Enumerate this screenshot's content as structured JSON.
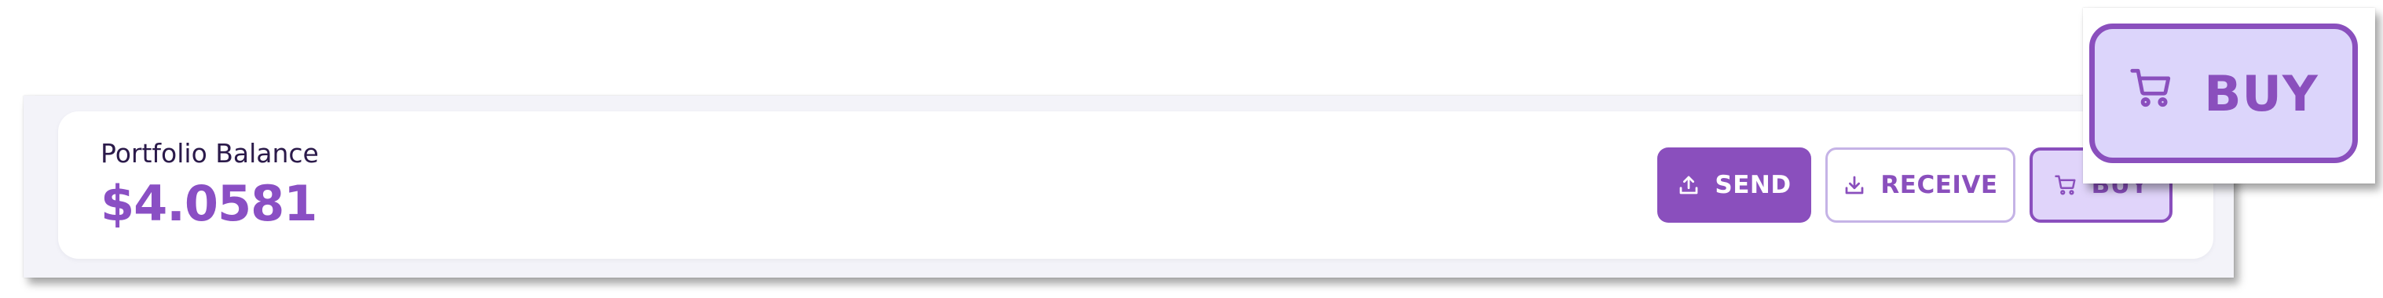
{
  "portfolio": {
    "label": "Portfolio Balance",
    "balance": "$4.0581"
  },
  "actions": {
    "send_label": "SEND",
    "receive_label": "RECEIVE",
    "buy_label": "BUY"
  },
  "icons": {
    "send": "upload-icon",
    "receive": "download-icon",
    "buy": "cart-icon"
  },
  "colors": {
    "accent": "#8a4fbd",
    "balance_text": "#8a4fc4",
    "buy_bg": "#e0d4fa",
    "receive_border": "#c5b3e6",
    "label_text": "#2b1a4a"
  }
}
